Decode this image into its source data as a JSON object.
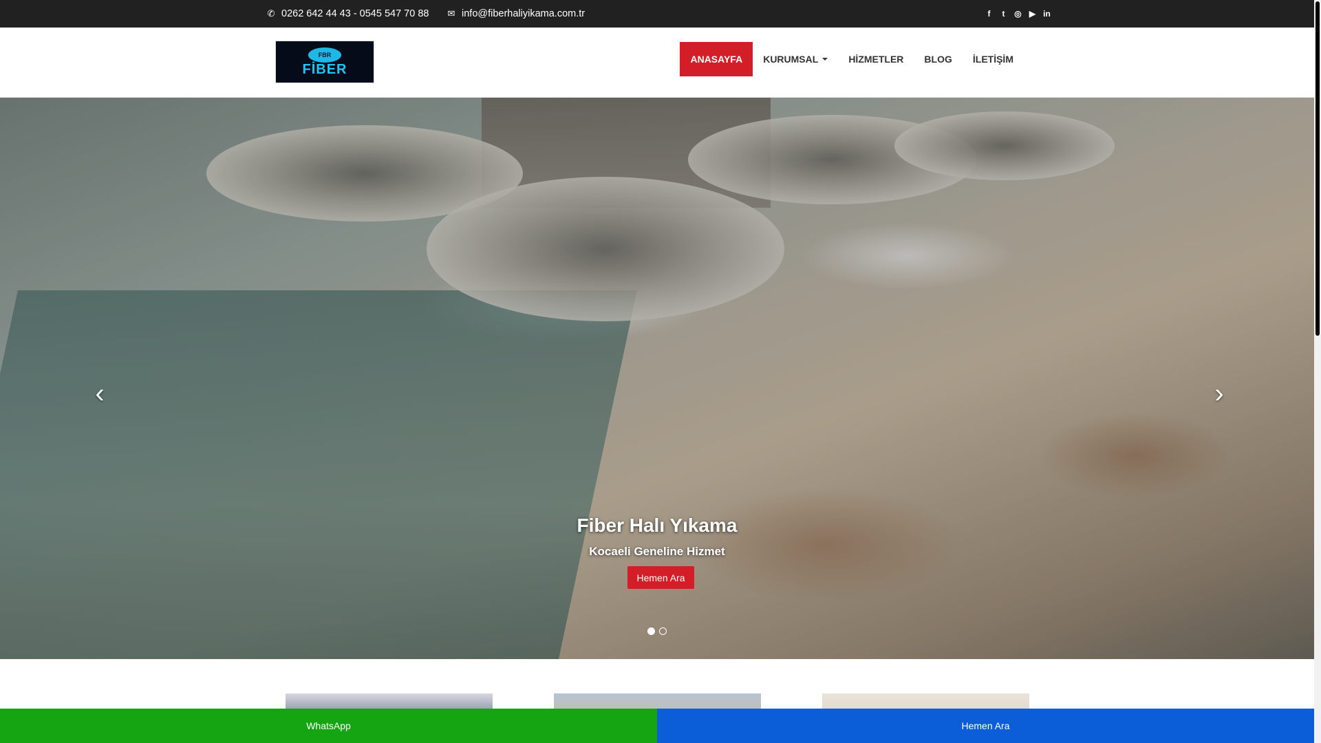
{
  "topbar": {
    "phone": "0262 642 44 43 - 0545 547 70 88",
    "email": "info@fiberhaliyikama.com.tr",
    "icons": {
      "phone": "phone-icon",
      "email": "envelope-icon"
    },
    "social": [
      {
        "name": "facebook-icon",
        "glyph": "f"
      },
      {
        "name": "twitter-icon",
        "glyph": "t"
      },
      {
        "name": "instagram-icon",
        "glyph": "◎"
      },
      {
        "name": "youtube-icon",
        "glyph": "▶"
      },
      {
        "name": "linkedin-icon",
        "glyph": "in"
      }
    ]
  },
  "logo": {
    "badge": "FBR",
    "word": "FİBER"
  },
  "nav": {
    "items": [
      {
        "label": "ANASAYFA",
        "active": true
      },
      {
        "label": "KURUMSAL",
        "dropdown": true
      },
      {
        "label": "HİZMETLER"
      },
      {
        "label": "BLOG"
      },
      {
        "label": "İLETİŞİM"
      }
    ]
  },
  "hero": {
    "title": "Fiber Halı Yıkama",
    "subtitle": "Kocaeli Geneline Hizmet",
    "button": "Hemen Ara",
    "prev": "‹",
    "next": "›",
    "slides": 2,
    "active_slide": 1
  },
  "footer_bar": {
    "whatsapp": "WhatsApp",
    "call": "Hemen Ara"
  },
  "colors": {
    "accent": "#d31e27",
    "topbar": "#212121",
    "whatsapp": "#16a512",
    "call": "#0b5ed7"
  }
}
